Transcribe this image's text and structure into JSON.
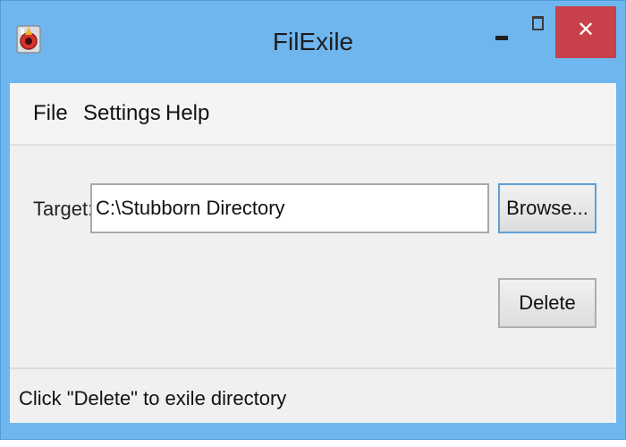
{
  "window": {
    "title": "FilExile",
    "controls": {
      "close_glyph": "✕"
    },
    "colors": {
      "frame": "#6fb6ef",
      "close_button": "#c7404a",
      "client_background": "#f0f0f0"
    }
  },
  "menu": {
    "items": [
      {
        "label": "File"
      },
      {
        "label": "Settings"
      },
      {
        "label": "Help"
      }
    ]
  },
  "form": {
    "target_label": "Target:",
    "target_value": "C:\\Stubborn Directory",
    "browse_label": "Browse...",
    "delete_label": "Delete"
  },
  "status": {
    "text": "Click \"Delete\" to exile directory"
  },
  "icons": {
    "app": "filexile-app-icon",
    "minimize": "minimize-icon",
    "maximize": "maximize-icon",
    "close": "close-icon"
  }
}
